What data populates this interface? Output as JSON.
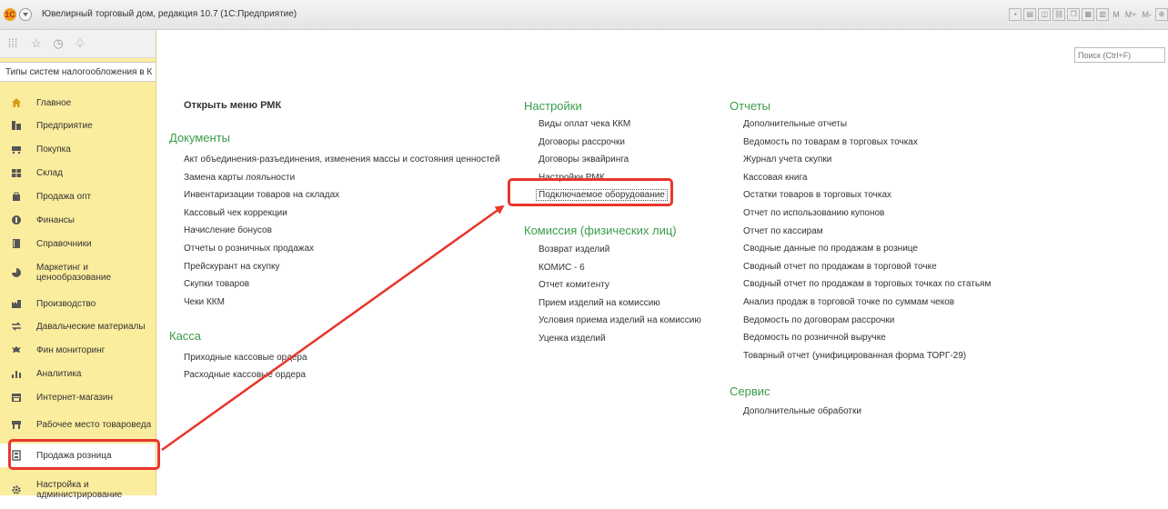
{
  "window": {
    "title": "Ювелирный торговый дом, редакция 10.7 (1С:Предприятие)",
    "logo_text": "1С",
    "toolbar_text": [
      "M",
      "M+",
      "M-"
    ]
  },
  "sidebar": {
    "open_tab": "Типы систем налогообложения в К",
    "items": [
      {
        "label": "Главное",
        "icon": "home-icon",
        "color": "#d89a12"
      },
      {
        "label": "Предприятие",
        "icon": "building-icon",
        "color": "#555555"
      },
      {
        "label": "Покупка",
        "icon": "cart-icon",
        "color": "#555555"
      },
      {
        "label": "Склад",
        "icon": "warehouse-icon",
        "color": "#555555"
      },
      {
        "label": "Продажа опт",
        "icon": "bag-icon",
        "color": "#555555"
      },
      {
        "label": "Финансы",
        "icon": "coin-icon",
        "color": "#555555"
      },
      {
        "label": "Справочники",
        "icon": "book-icon",
        "color": "#555555"
      },
      {
        "label": "Маркетинг и ценообразование",
        "icon": "chart-icon",
        "color": "#555555"
      },
      {
        "label": "Производство",
        "icon": "factory-icon",
        "color": "#555555"
      },
      {
        "label": "Давальческие материалы",
        "icon": "exchange-icon",
        "color": "#555555"
      },
      {
        "label": "Фин мониторинг",
        "icon": "eagle-icon",
        "color": "#555555"
      },
      {
        "label": "Аналитика",
        "icon": "analytics-icon",
        "color": "#555555"
      },
      {
        "label": "Интернет-магазин",
        "icon": "store-icon",
        "color": "#555555"
      },
      {
        "label": "Рабочее место товароведа",
        "icon": "workplace-icon",
        "color": "#555555"
      },
      {
        "label": "Продажа розница",
        "icon": "cashbox-icon",
        "color": "#555555"
      },
      {
        "label": "Настройка и администрирование",
        "icon": "gear-icon",
        "color": "#555555"
      }
    ]
  },
  "search": {
    "placeholder": "Поиск (Ctrl+F)"
  },
  "content": {
    "open_rmk": "Открыть меню РМК",
    "documents": {
      "title": "Документы",
      "items": [
        "Акт объединения-разъединения, изменения массы и состояния ценностей",
        "Замена карты лояльности",
        "Инвентаризации товаров на складах",
        "Кассовый чек коррекции",
        "Начисление бонусов",
        "Отчеты о розничных продажах",
        "Прейскурант на скупку",
        "Скупки товаров",
        "Чеки ККМ"
      ]
    },
    "kassa": {
      "title": "Касса",
      "items": [
        "Приходные кассовые ордера",
        "Расходные кассовые ордера"
      ]
    },
    "settings": {
      "title": "Настройки",
      "items": [
        "Виды оплат чека ККМ",
        "Договоры рассрочки",
        "Договоры эквайринга",
        "Настройки РМК",
        "Подключаемое оборудование"
      ]
    },
    "commission": {
      "title": "Комиссия (физических лиц)",
      "items": [
        "Возврат изделий",
        "КОМИС - 6",
        "Отчет комитенту",
        "Прием изделий на комиссию",
        "Условия приема изделий на комиссию",
        "Уценка изделий"
      ]
    },
    "reports": {
      "title": "Отчеты",
      "items": [
        "Дополнительные отчеты",
        "Ведомость по товарам в торговых точках",
        "Журнал учета скупки",
        "Кассовая книга",
        "Остатки товаров в торговых точках",
        "Отчет по использованию купонов",
        "Отчет по кассирам",
        "Сводные данные по продажам в рознице",
        "Сводный отчет по продажам в торговой точке",
        "Сводный отчет по продажам в торговых точках по статьям",
        "Анализ продаж в торговой точке по суммам чеков",
        "Ведомость по договорам рассрочки",
        "Ведомость по розничной выручке",
        "Товарный отчет (унифицированная форма ТОРГ-29)"
      ]
    },
    "service": {
      "title": "Сервис",
      "items": [
        "Дополнительные обработки"
      ]
    }
  },
  "annotation": {
    "color": "#e8362b"
  }
}
